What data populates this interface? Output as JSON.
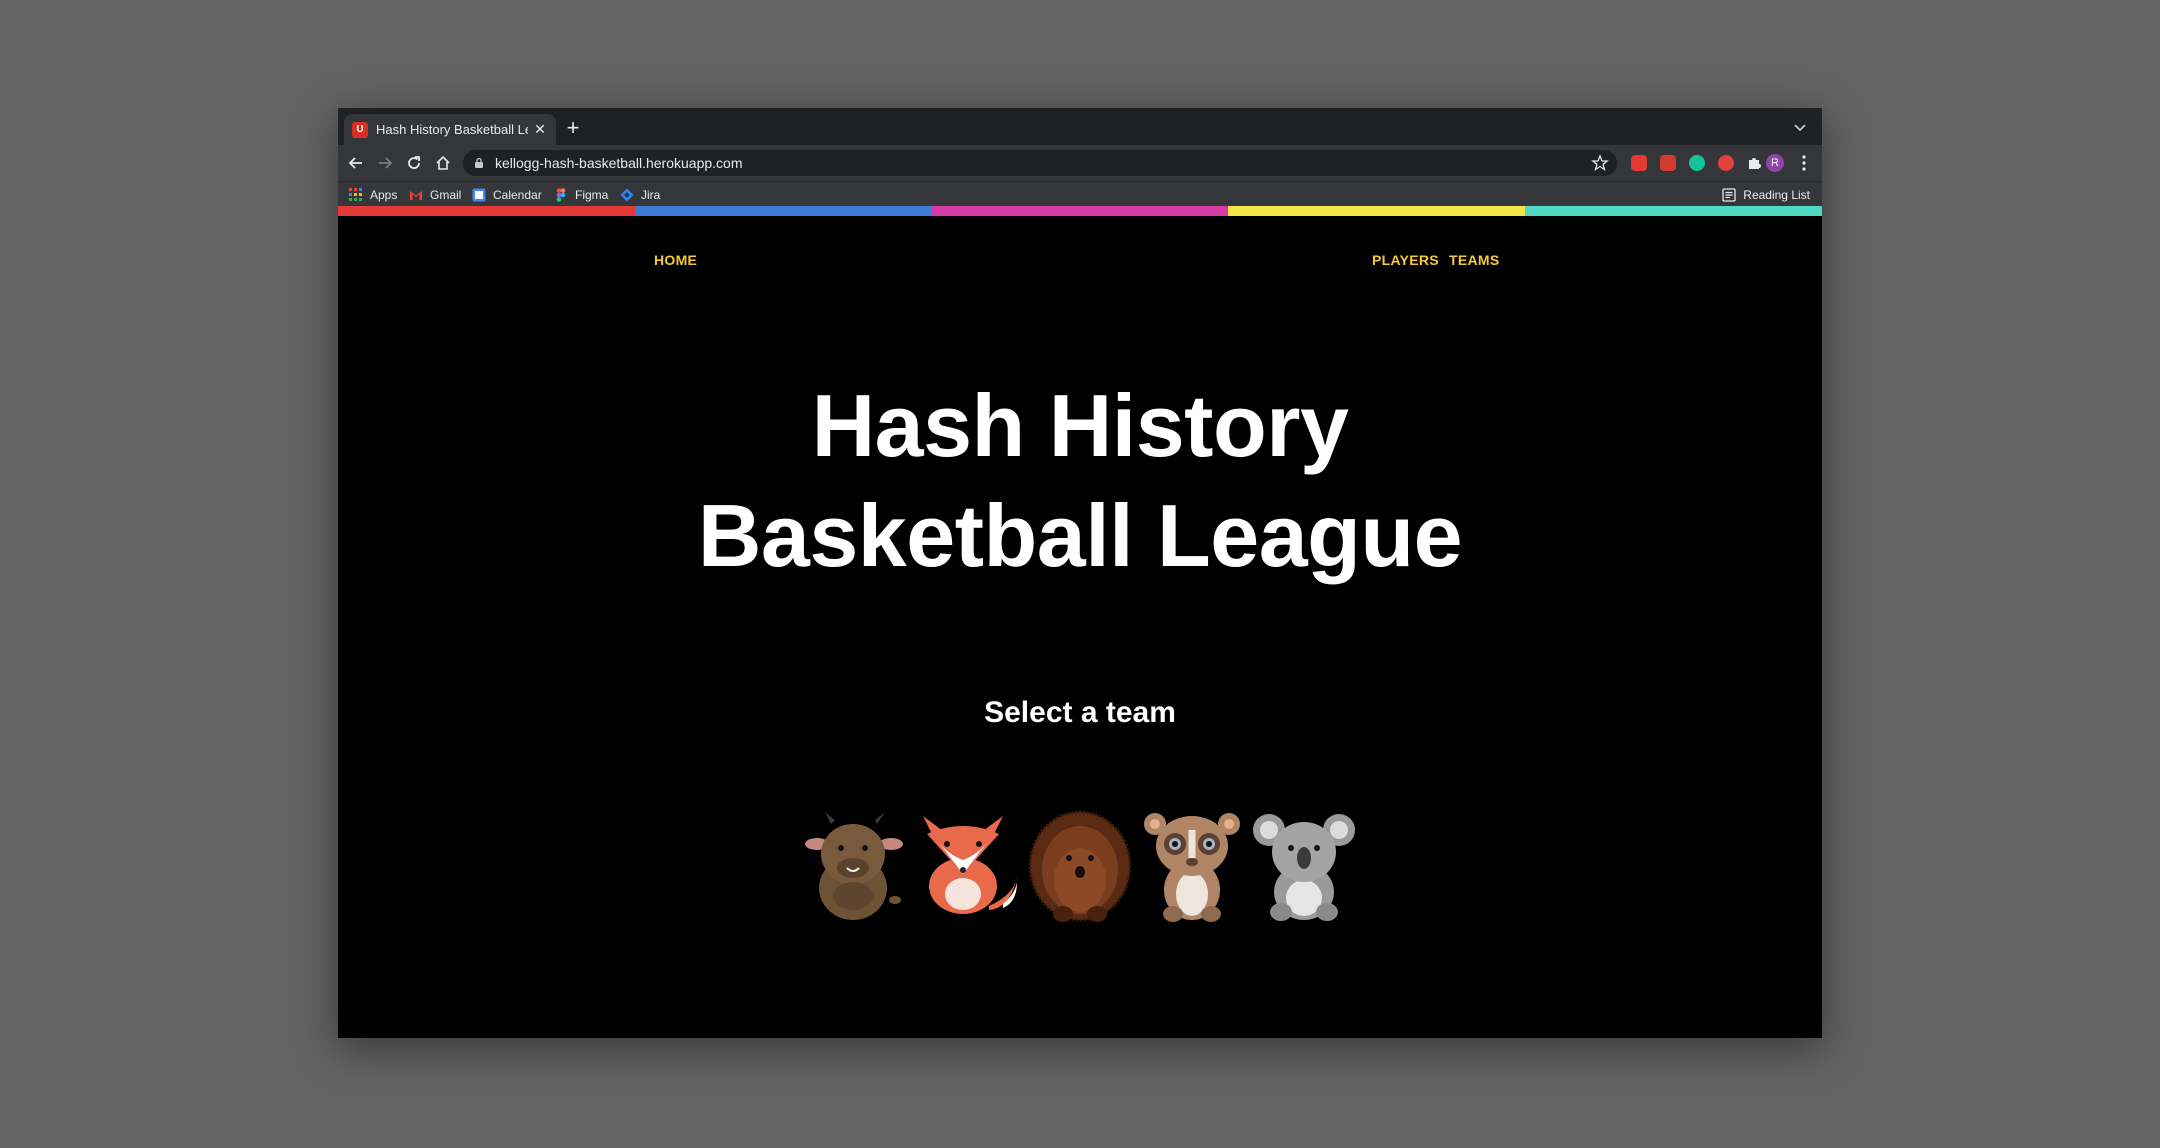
{
  "browser": {
    "tab_title": "Hash History Basketball League",
    "favicon_text": "U",
    "url": "kellogg-hash-basketball.herokuapp.com",
    "profile_initial": "R",
    "bookmarks": [
      "Apps",
      "Gmail",
      "Calendar",
      "Figma",
      "Jira"
    ],
    "reading_list": "Reading List"
  },
  "rainbow_colors": [
    "#e53935",
    "#3a7bd5",
    "#d63aa6",
    "#f3e447",
    "#4fd9c2"
  ],
  "nav": {
    "home": "HOME",
    "players": "PLAYERS",
    "teams": "TEAMS"
  },
  "hero": {
    "title_line1": "Hash History",
    "title_line2": "Basketball League"
  },
  "teams_section": {
    "heading": "Select a team",
    "mascots": [
      "bull-icon",
      "fox-icon",
      "hedgehog-icon",
      "lemur-icon",
      "koala-icon"
    ]
  }
}
